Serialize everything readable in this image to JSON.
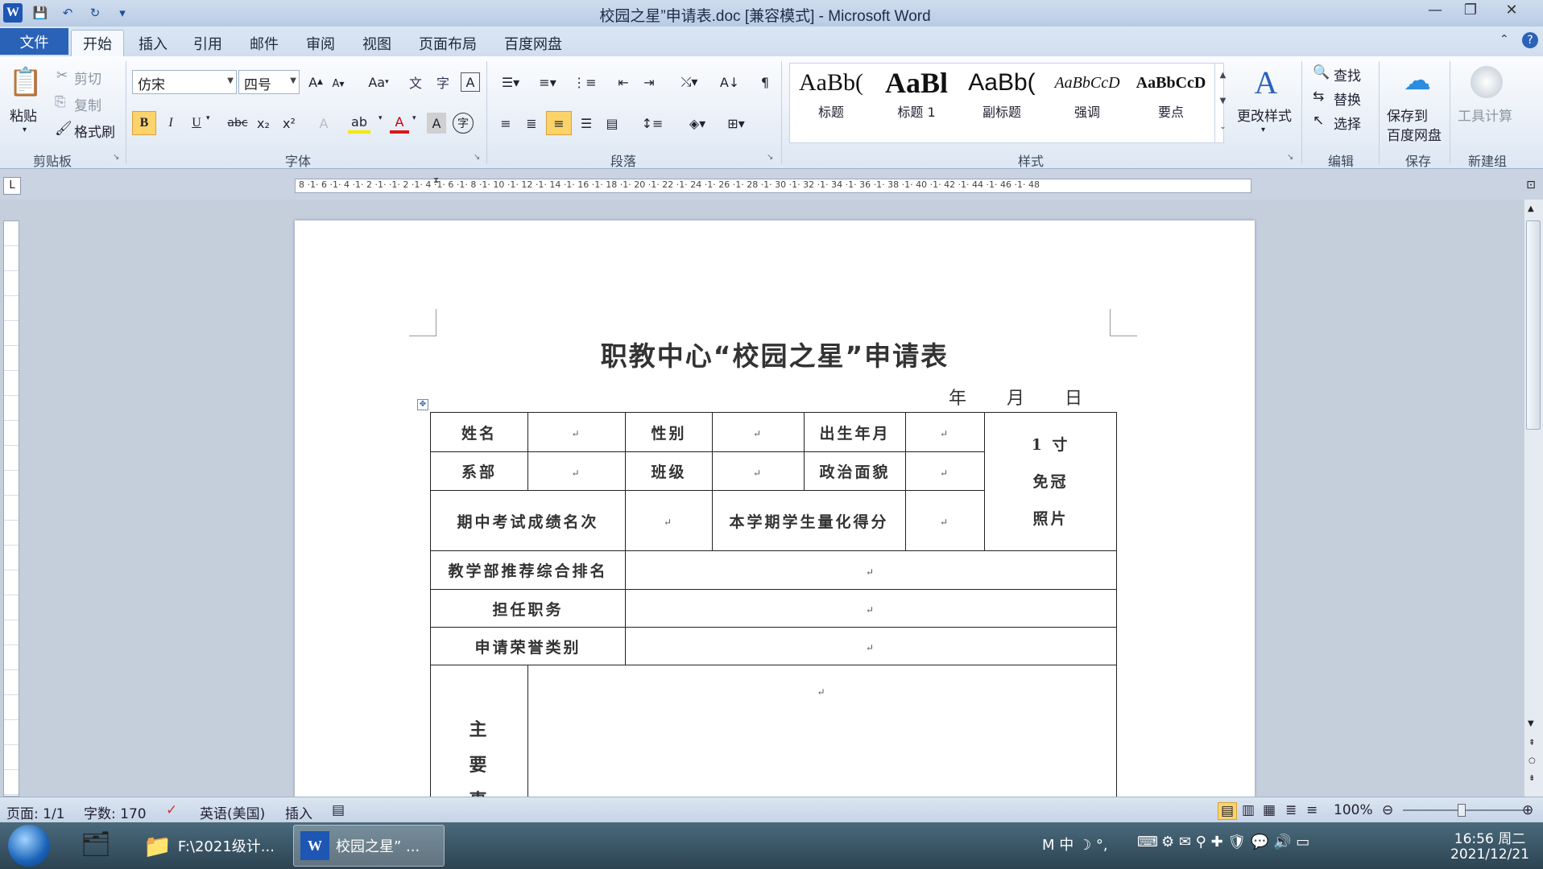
{
  "window": {
    "title": "校园之星”申请表.doc [兼容模式] - Microsoft Word",
    "logo": "W"
  },
  "tabs": [
    "文件",
    "开始",
    "插入",
    "引用",
    "邮件",
    "审阅",
    "视图",
    "页面布局",
    "百度网盘"
  ],
  "active_tab": "开始",
  "clipboard": {
    "paste": "粘贴",
    "cut": "剪切",
    "copy": "复制",
    "format_painter": "格式刷",
    "group": "剪贴板"
  },
  "font": {
    "name": "仿宋",
    "size": "四号",
    "group": "字体",
    "case_btn": "Aa",
    "bold": "B",
    "italic": "I",
    "underline": "U",
    "strike": "abc",
    "sub": "x₂",
    "sup": "x²",
    "color_glyph": "A"
  },
  "paragraph": {
    "group": "段落"
  },
  "styles": {
    "group": "样式",
    "items": [
      {
        "sample": "AaBb(",
        "name": "标题"
      },
      {
        "sample": "AaBl",
        "name": "标题 1"
      },
      {
        "sample": "AaBb(",
        "name": "副标题"
      },
      {
        "sample": "AaBbCcD",
        "name": "强调"
      },
      {
        "sample": "AaBbCcD",
        "name": "要点"
      }
    ],
    "change": "更改样式"
  },
  "editing": {
    "find": "查找",
    "replace": "替换",
    "select": "选择",
    "group": "编辑"
  },
  "baidu": {
    "save": "保存到",
    "save2": "百度网盘",
    "group": "保存"
  },
  "tools": {
    "calc": "工具计算",
    "group": "新建组"
  },
  "ruler": {
    "marks": "8 ·1· 6 ·1· 4 ·1· 2 ·1·  ·1· 2 ·1· 4 ·1· 6 ·1· 8 ·1· 10 ·1· 12 ·1· 14 ·1· 16 ·1· 18 ·1· 20 ·1· 22 ·1· 24 ·1· 26 ·1· 28 ·1· 30 ·1· 32 ·1· 34 ·1· 36 ·1· 38 ·1· 40 ·1· 42 ·1· 44 ·1· 46 ·1· 48",
    "tab_selector": "L"
  },
  "document": {
    "title": "职教中心“校园之星”申请表",
    "date_line": "年　　月　　日",
    "table": {
      "name": "姓名",
      "gender": "性别",
      "birth": "出生年月",
      "photo": [
        "1 寸",
        "免冠",
        "照片"
      ],
      "dept": "系部",
      "class": "班级",
      "politics": "政治面貌",
      "midterm": "期中考试成绩名次",
      "quant_score": "本学期学生量化得分",
      "ranking": "教学部推荐综合排名",
      "position": "担任职务",
      "honor": "申请荣誉类别",
      "main_chars": [
        "主",
        "要",
        "事"
      ]
    }
  },
  "status": {
    "page": "页面: 1/1",
    "words": "字数: 170",
    "lang": "英语(美国)",
    "mode": "插入",
    "zoom": "100%"
  },
  "taskbar": {
    "explorer": "F:\\2021级计...",
    "word": "校园之星” ...",
    "time": "16:56 周二",
    "date": "2021/12/21"
  }
}
